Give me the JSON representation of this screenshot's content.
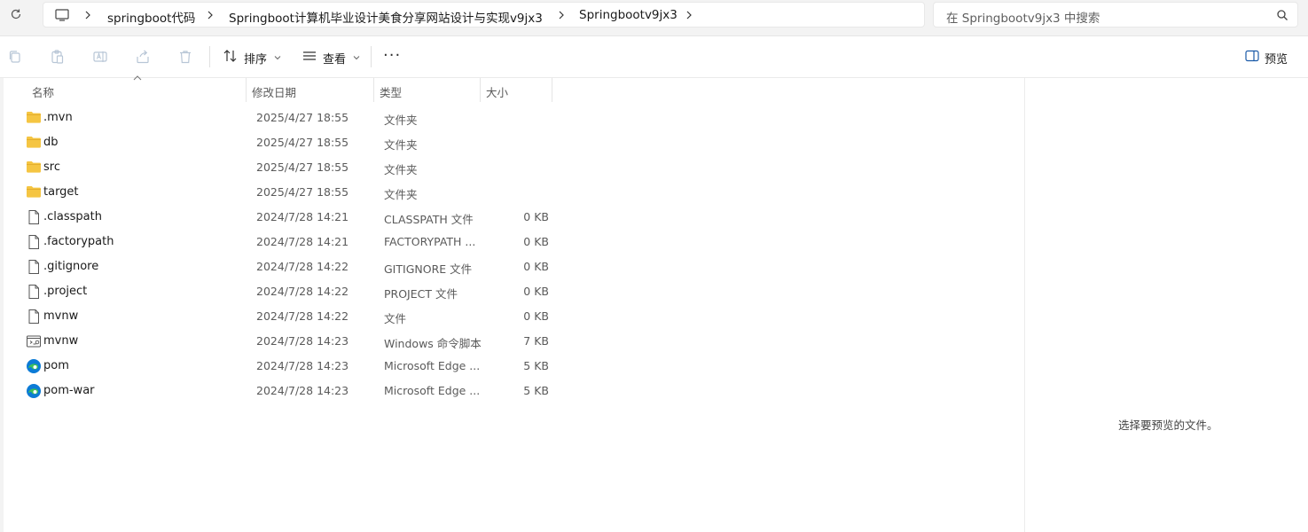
{
  "address": {
    "breadcrumbs": [
      "springboot代码",
      "Springboot计算机毕业设计美食分享网站设计与实现v9jx3",
      "Springbootv9jx3"
    ],
    "search_placeholder": "在 Springbootv9jx3 中搜索"
  },
  "toolbar": {
    "sort_label": "排序",
    "view_label": "查看",
    "more_label": "···",
    "preview_label": "预览"
  },
  "columns": {
    "name": "名称",
    "date": "修改日期",
    "type": "类型",
    "size": "大小"
  },
  "files": [
    {
      "name": ".mvn",
      "date": "2025/4/27 18:55",
      "type": "文件夹",
      "size": "",
      "icon": "folder-icon"
    },
    {
      "name": "db",
      "date": "2025/4/27 18:55",
      "type": "文件夹",
      "size": "",
      "icon": "folder-icon"
    },
    {
      "name": "src",
      "date": "2025/4/27 18:55",
      "type": "文件夹",
      "size": "",
      "icon": "folder-icon"
    },
    {
      "name": "target",
      "date": "2025/4/27 18:55",
      "type": "文件夹",
      "size": "",
      "icon": "folder-icon"
    },
    {
      "name": ".classpath",
      "date": "2024/7/28 14:21",
      "type": "CLASSPATH 文件",
      "size": "0 KB",
      "icon": "file-icon"
    },
    {
      "name": ".factorypath",
      "date": "2024/7/28 14:21",
      "type": "FACTORYPATH ...",
      "size": "0 KB",
      "icon": "file-icon"
    },
    {
      "name": ".gitignore",
      "date": "2024/7/28 14:22",
      "type": "GITIGNORE 文件",
      "size": "0 KB",
      "icon": "file-icon"
    },
    {
      "name": ".project",
      "date": "2024/7/28 14:22",
      "type": "PROJECT 文件",
      "size": "0 KB",
      "icon": "file-icon"
    },
    {
      "name": "mvnw",
      "date": "2024/7/28 14:22",
      "type": "文件",
      "size": "0 KB",
      "icon": "file-icon"
    },
    {
      "name": "mvnw",
      "date": "2024/7/28 14:23",
      "type": "Windows 命令脚本",
      "size": "7 KB",
      "icon": "script-icon"
    },
    {
      "name": "pom",
      "date": "2024/7/28 14:23",
      "type": "Microsoft Edge ...",
      "size": "5 KB",
      "icon": "edge-icon"
    },
    {
      "name": "pom-war",
      "date": "2024/7/28 14:23",
      "type": "Microsoft Edge ...",
      "size": "5 KB",
      "icon": "edge-icon"
    }
  ],
  "preview": {
    "empty_text": "选择要预览的文件。"
  },
  "colors": {
    "folder": "#f5c542",
    "edge_blue": "#0c7bd6",
    "edge_green": "#3cc05a"
  }
}
